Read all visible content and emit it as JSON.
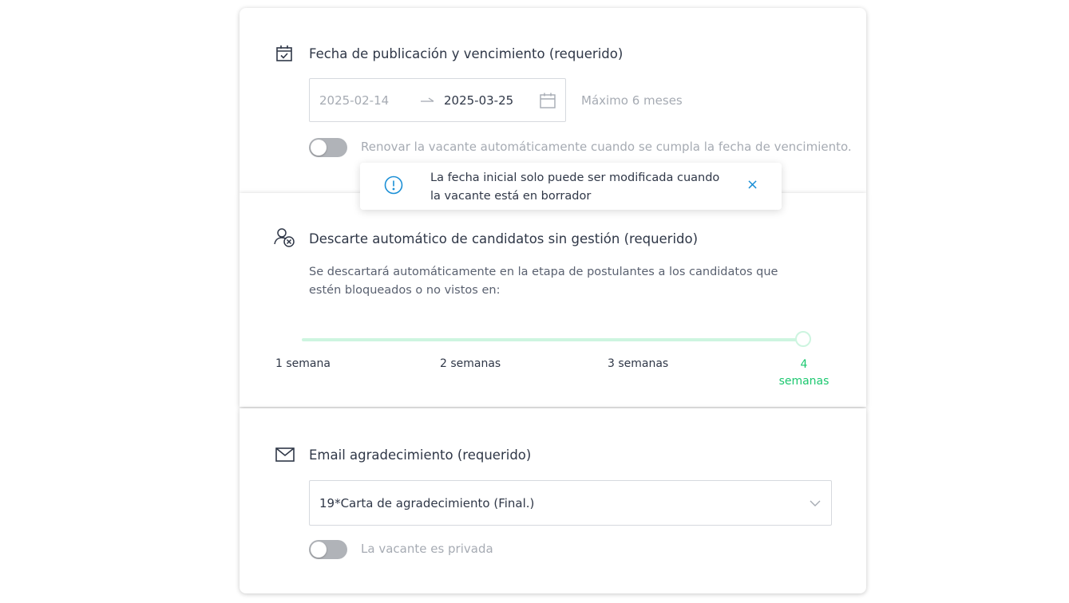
{
  "publication": {
    "title": "Fecha de publicación y vencimiento (requerido)",
    "start_date": "2025-02-14",
    "end_date": "2025-03-25",
    "arrow": "→",
    "max_note": "Máximo 6 meses",
    "renew_label": "Renovar la vacante automáticamente cuando se cumpla la fecha de vencimiento.",
    "renew_enabled": false
  },
  "tooltip": {
    "text": "La fecha inicial solo puede ser modificada cuando la vacante está en borrador",
    "close": "×",
    "accent": "#1b8fd6"
  },
  "auto_discard": {
    "title": "Descarte automático de candidatos sin gestión (requerido)",
    "description": "Se descartará automáticamente en la etapa de postulantes a los candidatos que estén bloqueados o no vistos en:",
    "marks": [
      "1 semana",
      "2 semanas",
      "3 semanas",
      "4 semanas"
    ],
    "selected_index": 3,
    "accent": "#1bc86f"
  },
  "thanks_email": {
    "title": "Email agradecimiento (requerido)",
    "selected": "19*Carta de agradecimiento (Final.)",
    "private_label": "La vacante es privada",
    "private_enabled": false
  },
  "icons": {
    "calendar_check": "calendar-check-icon",
    "calendar": "calendar-icon",
    "user_remove": "user-remove-icon",
    "mail": "mail-icon",
    "info": "info-icon",
    "chevron": "chevron-down-icon"
  }
}
